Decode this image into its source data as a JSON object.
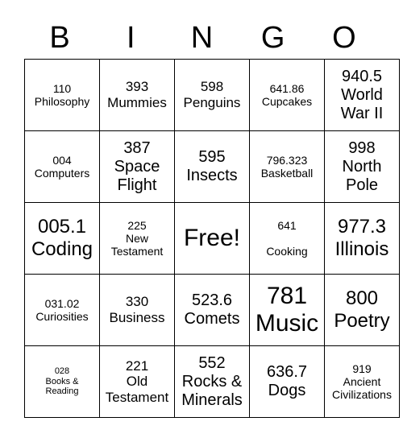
{
  "header": [
    "B",
    "I",
    "N",
    "G",
    "O"
  ],
  "rows": [
    [
      {
        "text": "110\nPhilosophy",
        "size": "s2"
      },
      {
        "text": "393\nMummies",
        "size": "s3"
      },
      {
        "text": "598\nPenguins",
        "size": "s3"
      },
      {
        "text": "641.86\nCupcakes",
        "size": "s2"
      },
      {
        "text": "940.5\nWorld\nWar II",
        "size": "s4"
      }
    ],
    [
      {
        "text": "004\nComputers",
        "size": "s2"
      },
      {
        "text": "387\nSpace\nFlight",
        "size": "s4"
      },
      {
        "text": "595\nInsects",
        "size": "s4"
      },
      {
        "text": "796.323\nBasketball",
        "size": "s2"
      },
      {
        "text": "998\nNorth\nPole",
        "size": "s4"
      }
    ],
    [
      {
        "text": "005.1\nCoding",
        "size": "s5"
      },
      {
        "text": "225\nNew\nTestament",
        "size": "s2"
      },
      {
        "text": "Free!",
        "size": "s6"
      },
      {
        "text": "641\n\nCooking",
        "size": "s2"
      },
      {
        "text": "977.3\nIllinois",
        "size": "s5"
      }
    ],
    [
      {
        "text": "031.02\nCuriosities",
        "size": "s2"
      },
      {
        "text": "330\nBusiness",
        "size": "s3"
      },
      {
        "text": "523.6\nComets",
        "size": "s4"
      },
      {
        "text": "781\nMusic",
        "size": "s6"
      },
      {
        "text": "800\nPoetry",
        "size": "s5"
      }
    ],
    [
      {
        "text": "028\nBooks &\nReading",
        "size": "s1"
      },
      {
        "text": "221\nOld\nTestament",
        "size": "s3"
      },
      {
        "text": "552\nRocks &\nMinerals",
        "size": "s4"
      },
      {
        "text": "636.7\nDogs",
        "size": "s4"
      },
      {
        "text": "919\nAncient\nCivilizations",
        "size": "s2"
      }
    ]
  ]
}
